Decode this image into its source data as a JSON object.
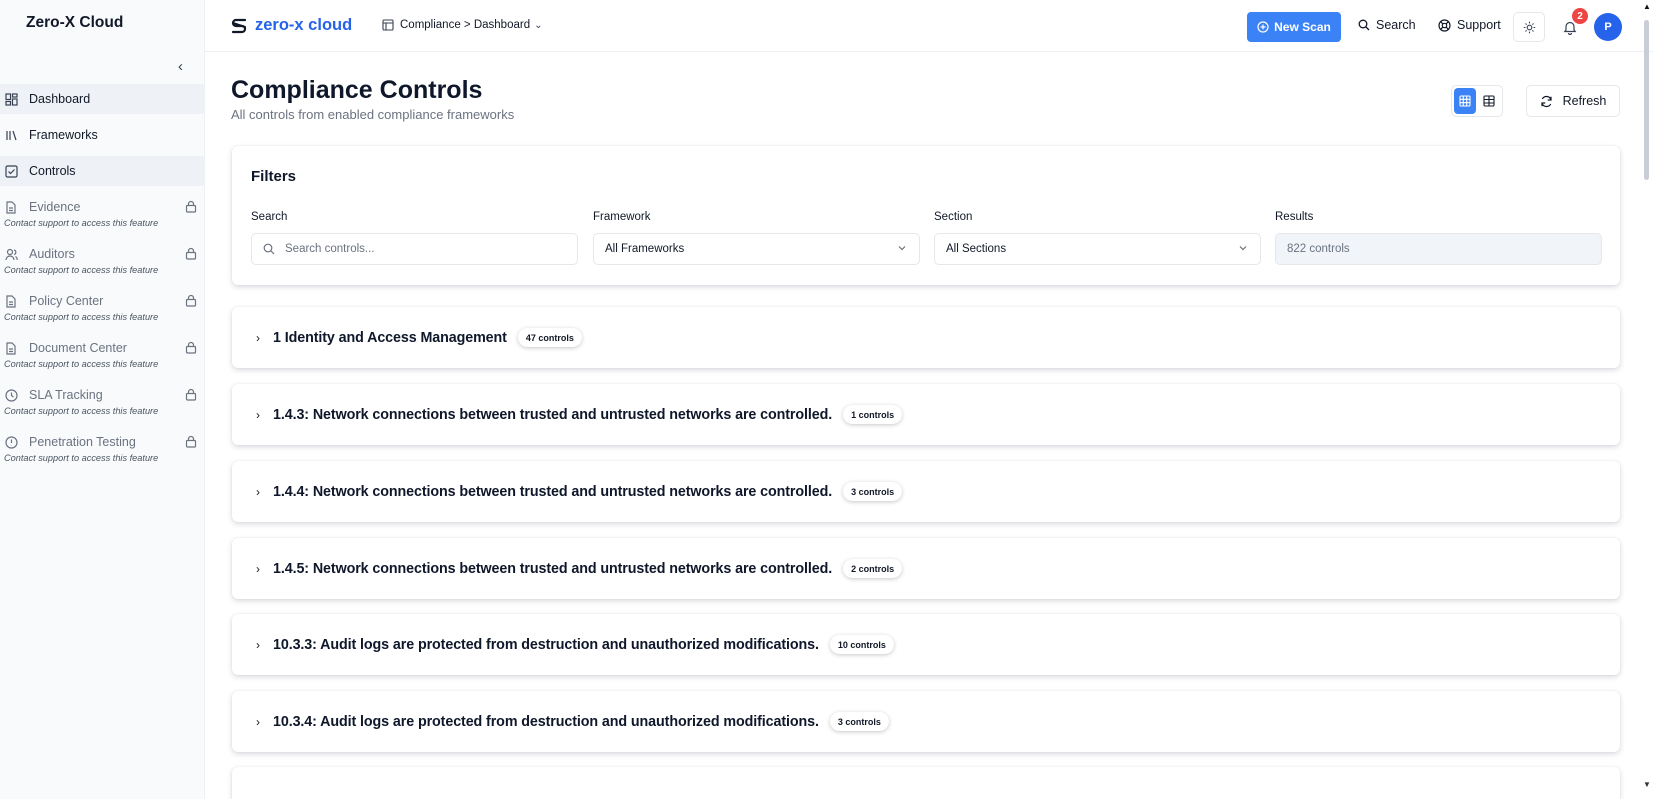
{
  "sidebar": {
    "title": "Zero-X Cloud",
    "collapse_icon": "chevron-left-icon",
    "items": [
      {
        "label": "Dashboard",
        "icon": "dashboard-icon"
      },
      {
        "label": "Frameworks",
        "icon": "library-icon"
      },
      {
        "label": "Controls",
        "icon": "checkbox-icon"
      },
      {
        "label": "Evidence",
        "icon": "file-icon",
        "hint": "Contact support to access this feature"
      },
      {
        "label": "Auditors",
        "icon": "users-icon",
        "hint": "Contact support to access this feature"
      },
      {
        "label": "Policy Center",
        "icon": "file-icon",
        "hint": "Contact support to access this feature"
      },
      {
        "label": "Document Center",
        "icon": "file-icon",
        "hint": "Contact support to access this feature"
      },
      {
        "label": "SLA Tracking",
        "icon": "clock-icon",
        "hint": "Contact support to access this feature"
      },
      {
        "label": "Penetration Testing",
        "icon": "alert-circle-icon",
        "hint": "Contact support to access this feature"
      }
    ]
  },
  "header": {
    "brand": "zero-x cloud",
    "breadcrumb": "Compliance > Dashboard",
    "new_scan": "New Scan",
    "search": "Search",
    "support": "Support",
    "notifications_count": "2",
    "avatar_initial": "P"
  },
  "page": {
    "title": "Compliance Controls",
    "subtitle": "All controls from enabled compliance frameworks",
    "refresh": "Refresh"
  },
  "filters": {
    "title": "Filters",
    "search_label": "Search",
    "search_placeholder": "Search controls...",
    "framework_label": "Framework",
    "framework_value": "All Frameworks",
    "section_label": "Section",
    "section_value": "All Sections",
    "results_label": "Results",
    "results_value": "822 controls"
  },
  "groups": [
    {
      "title": "1 Identity and Access Management",
      "count": "47 controls"
    },
    {
      "title": "1.4.3: Network connections between trusted and untrusted networks are controlled.",
      "count": "1 controls"
    },
    {
      "title": "1.4.4: Network connections between trusted and untrusted networks are controlled.",
      "count": "3 controls"
    },
    {
      "title": "1.4.5: Network connections between trusted and untrusted networks are controlled.",
      "count": "2 controls"
    },
    {
      "title": "10.3.3: Audit logs are protected from destruction and unauthorized modifications.",
      "count": "10 controls"
    },
    {
      "title": "10.3.4: Audit logs are protected from destruction and unauthorized modifications.",
      "count": "3 controls"
    }
  ],
  "colors": {
    "accent": "#3b82f6",
    "brand": "#2563eb",
    "badge": "#ef4444"
  }
}
